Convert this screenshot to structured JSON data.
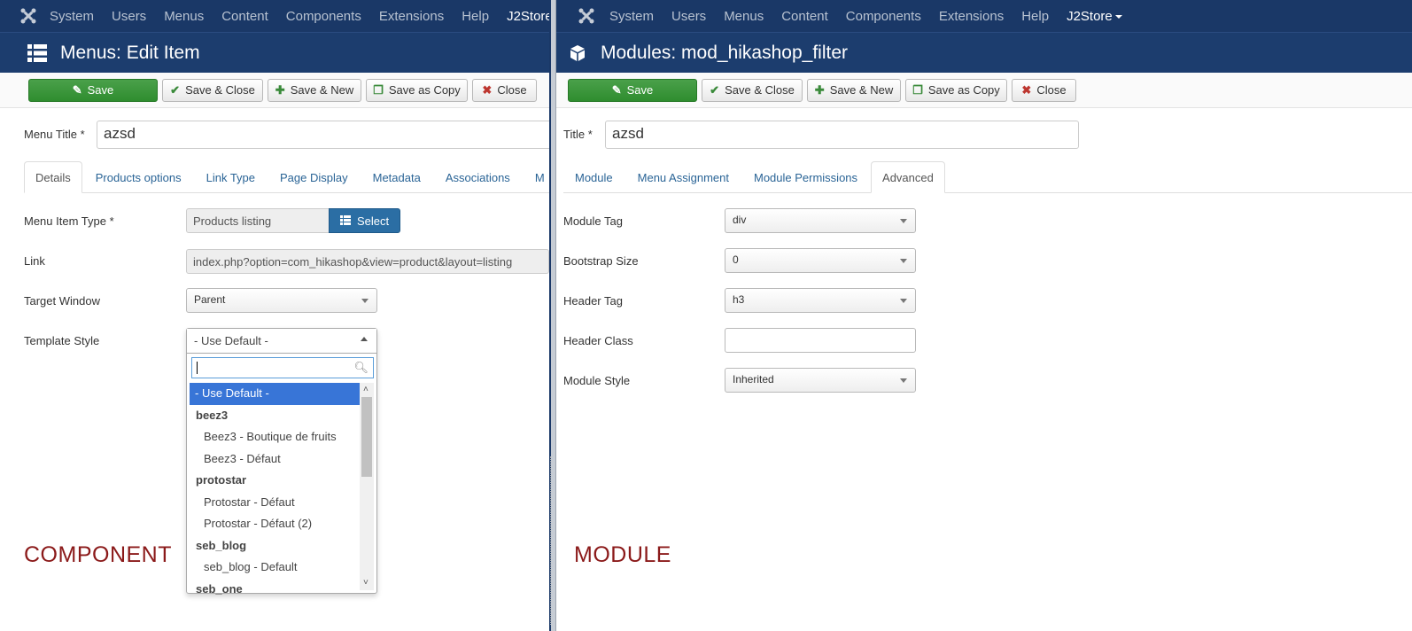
{
  "left": {
    "nav": [
      "System",
      "Users",
      "Menus",
      "Content",
      "Components",
      "Extensions",
      "Help",
      "J2Store"
    ],
    "title": "Menus: Edit Item",
    "toolbar": {
      "save": "Save",
      "save_close": "Save & Close",
      "save_new": "Save & New",
      "save_copy": "Save as Copy",
      "close": "Close"
    },
    "menu_title_label": "Menu Title *",
    "menu_title_value": "azsd",
    "tabs": [
      "Details",
      "Products options",
      "Link Type",
      "Page Display",
      "Metadata",
      "Associations",
      "M"
    ],
    "fields": {
      "item_type_label": "Menu Item Type *",
      "item_type_value": "Products listing",
      "select_button": "Select",
      "link_label": "Link",
      "link_value": "index.php?option=com_hikashop&view=product&layout=listing",
      "target_label": "Target Window",
      "target_value": "Parent",
      "template_label": "Template Style",
      "template_value": "- Use Default -"
    },
    "dropdown": {
      "items": [
        {
          "text": "- Use Default -",
          "kind": "selected"
        },
        {
          "text": "beez3",
          "kind": "group"
        },
        {
          "text": "Beez3 - Boutique de fruits",
          "kind": "opt"
        },
        {
          "text": "Beez3 - Défaut",
          "kind": "opt"
        },
        {
          "text": "protostar",
          "kind": "group"
        },
        {
          "text": "Protostar - Défaut",
          "kind": "opt"
        },
        {
          "text": "Protostar - Défaut (2)",
          "kind": "opt"
        },
        {
          "text": "seb_blog",
          "kind": "group"
        },
        {
          "text": "seb_blog - Default",
          "kind": "opt"
        },
        {
          "text": "seb_one",
          "kind": "group"
        }
      ]
    },
    "caption": "COMPONENT"
  },
  "right": {
    "nav": [
      "System",
      "Users",
      "Menus",
      "Content",
      "Components",
      "Extensions",
      "Help",
      "J2Store"
    ],
    "title": "Modules: mod_hikashop_filter",
    "toolbar": {
      "save": "Save",
      "save_close": "Save & Close",
      "save_new": "Save & New",
      "save_copy": "Save as Copy",
      "close": "Close"
    },
    "title_label": "Title *",
    "title_value": "azsd",
    "tabs": [
      "Module",
      "Menu Assignment",
      "Module Permissions",
      "Advanced"
    ],
    "fields": {
      "module_tag_label": "Module Tag",
      "module_tag_value": "div",
      "bootstrap_label": "Bootstrap Size",
      "bootstrap_value": "0",
      "header_tag_label": "Header Tag",
      "header_tag_value": "h3",
      "header_class_label": "Header Class",
      "header_class_value": "",
      "module_style_label": "Module Style",
      "module_style_value": "Inherited"
    },
    "caption": "MODULE"
  },
  "colors": {
    "nav_bg": "#1a3867",
    "title_bg": "#1c3d6e",
    "save_green": "#3a953a",
    "link_blue": "#2a6496",
    "caption_red": "#8b1a1a",
    "highlight": "#3875d7"
  },
  "icons": [
    "joomla-icon",
    "list-icon",
    "cube-icon",
    "edit-icon",
    "check-icon",
    "plus-icon",
    "copy-icon",
    "close-circle-icon",
    "search-icon",
    "caret-down-icon"
  ]
}
